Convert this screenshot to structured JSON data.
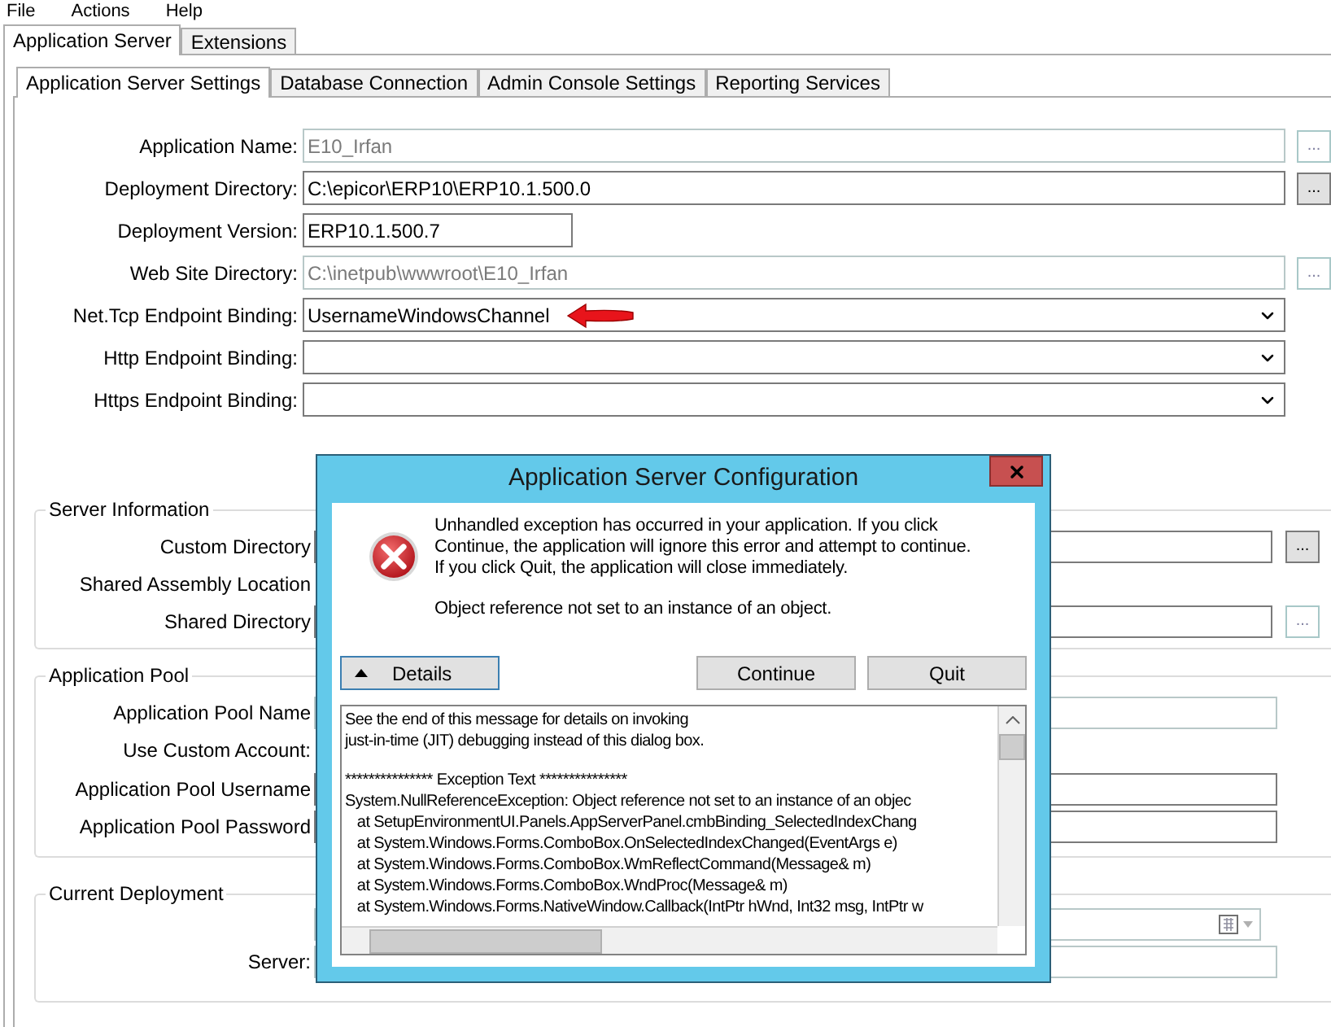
{
  "menu": [
    {
      "label": "File"
    },
    {
      "label": "Actions"
    },
    {
      "label": "Help"
    }
  ],
  "outer_tabs": [
    {
      "label": "Application Server",
      "selected": true
    },
    {
      "label": "Extensions",
      "selected": false
    }
  ],
  "inner_tabs": [
    {
      "label": "Application Server Settings",
      "selected": true
    },
    {
      "label": "Database Connection",
      "selected": false
    },
    {
      "label": "Admin Console Settings",
      "selected": false
    },
    {
      "label": "Reporting Services",
      "selected": false
    }
  ],
  "settings": [
    {
      "label": "Application Name:",
      "kind": "text",
      "value": "E10_Irfan",
      "disabled": true,
      "browse": "..."
    },
    {
      "label": "Deployment Directory:",
      "kind": "text",
      "value": "C:\\epicor\\ERP10\\ERP10.1.500.0",
      "disabled": false,
      "browse": "..."
    },
    {
      "label": "Deployment Version:",
      "kind": "short",
      "value": "ERP10.1.500.7",
      "disabled": false
    },
    {
      "label": "Web Site Directory:",
      "kind": "text",
      "value": "C:\\inetpub\\wwwroot\\E10_Irfan",
      "disabled": true,
      "browse": "..."
    },
    {
      "label": "Net.Tcp Endpoint Binding:",
      "kind": "combo",
      "value": "UsernameWindowsChannel",
      "disabled": false,
      "annotated": true
    },
    {
      "label": "Http Endpoint Binding:",
      "kind": "combo",
      "disabled": false
    },
    {
      "label": "Https Endpoint Binding:",
      "kind": "combo",
      "disabled": false
    }
  ],
  "groups": [
    {
      "title": "Server Information",
      "rows": [
        {
          "label": "Custom Directory",
          "kind": "text",
          "disabled": false,
          "browse": "...",
          "browse_disabled": false
        },
        {
          "label": "Shared Assembly Location",
          "kind": "none"
        },
        {
          "label": "Shared Directory",
          "kind": "text",
          "disabled": false,
          "browse": "...",
          "browse_disabled": true
        }
      ]
    },
    {
      "title": "Application Pool",
      "rows": [
        {
          "label": "Application Pool Name",
          "kind": "text",
          "disabled": true
        },
        {
          "label": "Use Custom Account:",
          "kind": "none"
        },
        {
          "label": "Application Pool Username",
          "kind": "text",
          "disabled": false
        },
        {
          "label": "Application Pool Password",
          "kind": "text",
          "disabled": false
        }
      ]
    },
    {
      "title": "Current Deployment",
      "rows": [
        {
          "kind": "date",
          "disabled": true
        },
        {
          "label": "Server:",
          "kind": "text",
          "disabled": true
        }
      ]
    }
  ],
  "dialog": {
    "title": "Application Server Configuration",
    "message_lines": [
      "Unhandled exception has occurred in your application. If you click",
      "Continue, the application will ignore this error and attempt to continue.",
      "If you click Quit, the application will close immediately."
    ],
    "error": "Object reference not set to an instance of an object.",
    "details": {
      "label": "Details",
      "expanded": true
    },
    "buttons": [
      {
        "label": "Continue"
      },
      {
        "label": "Quit"
      }
    ],
    "detail_paragraphs": [
      [
        "See the end of this message for details on invoking",
        "just-in-time (JIT) debugging instead of this dialog box."
      ],
      [
        "*************** Exception Text ***************",
        "System.NullReferenceException: Object reference not set to an instance of an objec",
        "   at SetupEnvironmentUI.Panels.AppServerPanel.cmbBinding_SelectedIndexChang",
        "   at System.Windows.Forms.ComboBox.OnSelectedIndexChanged(EventArgs e)",
        "   at System.Windows.Forms.ComboBox.WmReflectCommand(Message& m)",
        "   at System.Windows.Forms.ComboBox.WndProc(Message& m)",
        "   at System.Windows.Forms.NativeWindow.Callback(IntPtr hWnd, Int32 msg, IntPtr w"
      ]
    ]
  }
}
